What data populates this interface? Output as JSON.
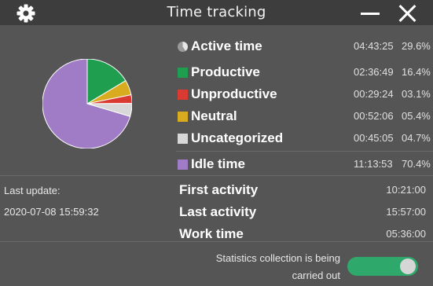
{
  "window": {
    "title": "Time tracking",
    "settings_icon": "gear-icon",
    "minimize_icon": "minimize-icon",
    "close_icon": "close-icon"
  },
  "summary": {
    "active": {
      "label": "Active time",
      "duration": "04:43:25",
      "percent": "29.6%",
      "icon": "pie-chart-icon"
    },
    "categories": [
      {
        "label": "Productive",
        "duration": "02:36:49",
        "percent": "16.4%",
        "color": "#1e9e4e"
      },
      {
        "label": "Unproductive",
        "duration": "00:29:24",
        "percent": "03.1%",
        "color": "#d93a32"
      },
      {
        "label": "Neutral",
        "duration": "00:52:06",
        "percent": "05.4%",
        "color": "#d8ac1e"
      },
      {
        "label": "Uncategorized",
        "duration": "00:45:05",
        "percent": "04.7%",
        "color": "#d8d8d8"
      }
    ],
    "idle": {
      "label": "Idle time",
      "duration": "11:13:53",
      "percent": "70.4%",
      "color": "#a07cc6"
    }
  },
  "pie": {
    "slices": [
      {
        "name": "Productive",
        "value": 16.4,
        "color": "#1e9e4e"
      },
      {
        "name": "Neutral",
        "value": 5.4,
        "color": "#d8ac1e"
      },
      {
        "name": "Unproductive",
        "value": 3.1,
        "color": "#d93a32"
      },
      {
        "name": "Uncategorized",
        "value": 4.7,
        "color": "#d8d8d8"
      },
      {
        "name": "Idle time",
        "value": 70.4,
        "color": "#a07cc6"
      }
    ]
  },
  "last_update": {
    "label": "Last update:",
    "value": "2020-07-08 15:59:32"
  },
  "details": [
    {
      "label": "First activity",
      "value": "10:21:00"
    },
    {
      "label": "Last activity",
      "value": "15:57:00"
    },
    {
      "label": "Work time",
      "value": "05:36:00"
    }
  ],
  "footer": {
    "status_text": "Statistics collection is being carried out",
    "toggle_on": true,
    "toggle_color": "#2ea86b"
  }
}
